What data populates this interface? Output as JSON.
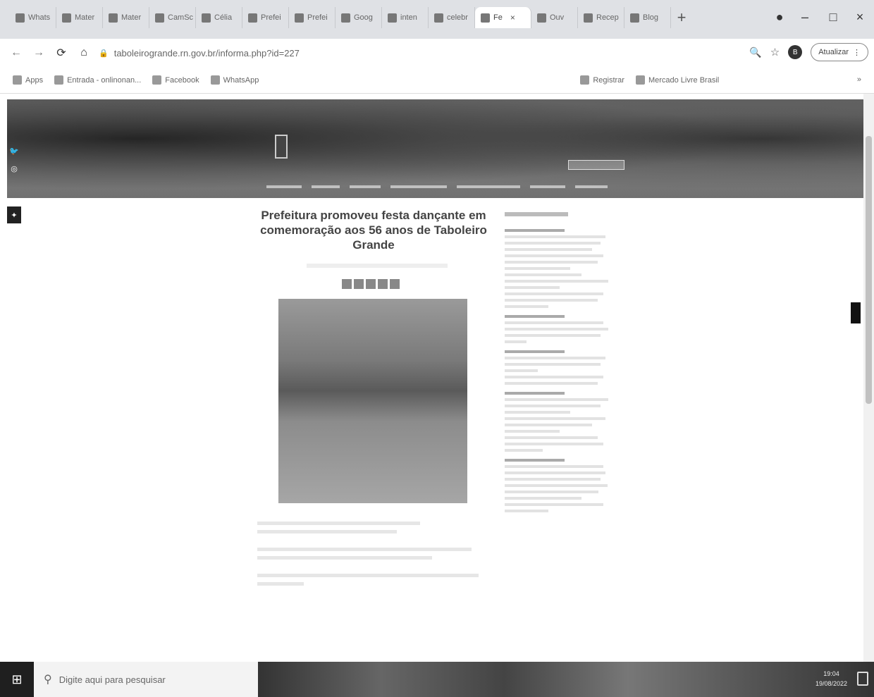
{
  "browser": {
    "tabs": [
      {
        "label": "Whats"
      },
      {
        "label": "Mater"
      },
      {
        "label": "Mater"
      },
      {
        "label": "CamSc"
      },
      {
        "label": "Célia"
      },
      {
        "label": "Prefei"
      },
      {
        "label": "Prefei"
      },
      {
        "label": "Goog"
      },
      {
        "label": "inten"
      },
      {
        "label": "celebr"
      },
      {
        "label": "Fe",
        "active": true
      },
      {
        "label": "Ouv"
      },
      {
        "label": "Recep"
      },
      {
        "label": "Blog"
      }
    ],
    "close_tab_glyph": "×",
    "new_tab_glyph": "+",
    "window_controls": [
      "–",
      "□",
      "×"
    ],
    "url": "taboleirogrande.rn.gov.br/informa.php?id=227",
    "profile_initial": "B",
    "update_label": "Atualizar",
    "bookmarks": [
      {
        "label": "Apps",
        "faint": false
      },
      {
        "label": "Entrada - onlinonan...",
        "faint": false
      },
      {
        "label": "Facebook",
        "faint": false
      },
      {
        "label": "WhatsApp",
        "faint": false
      },
      {
        "label": "Registrar",
        "faint": false
      },
      {
        "label": "Mercado Livre Brasil",
        "faint": false
      }
    ],
    "bookmarks_more": "»"
  },
  "page": {
    "article_title": "Prefeitura promoveu festa dançante em comemoração aos 56 anos de Taboleiro Grande"
  },
  "taskbar": {
    "search_placeholder": "Digite aqui para pesquisar",
    "time": "19:04",
    "date": "19/08/2022"
  },
  "colors": {
    "tabstrip_bg": "#dfe1e5",
    "taskbar_bg": "#1f1f1f"
  }
}
